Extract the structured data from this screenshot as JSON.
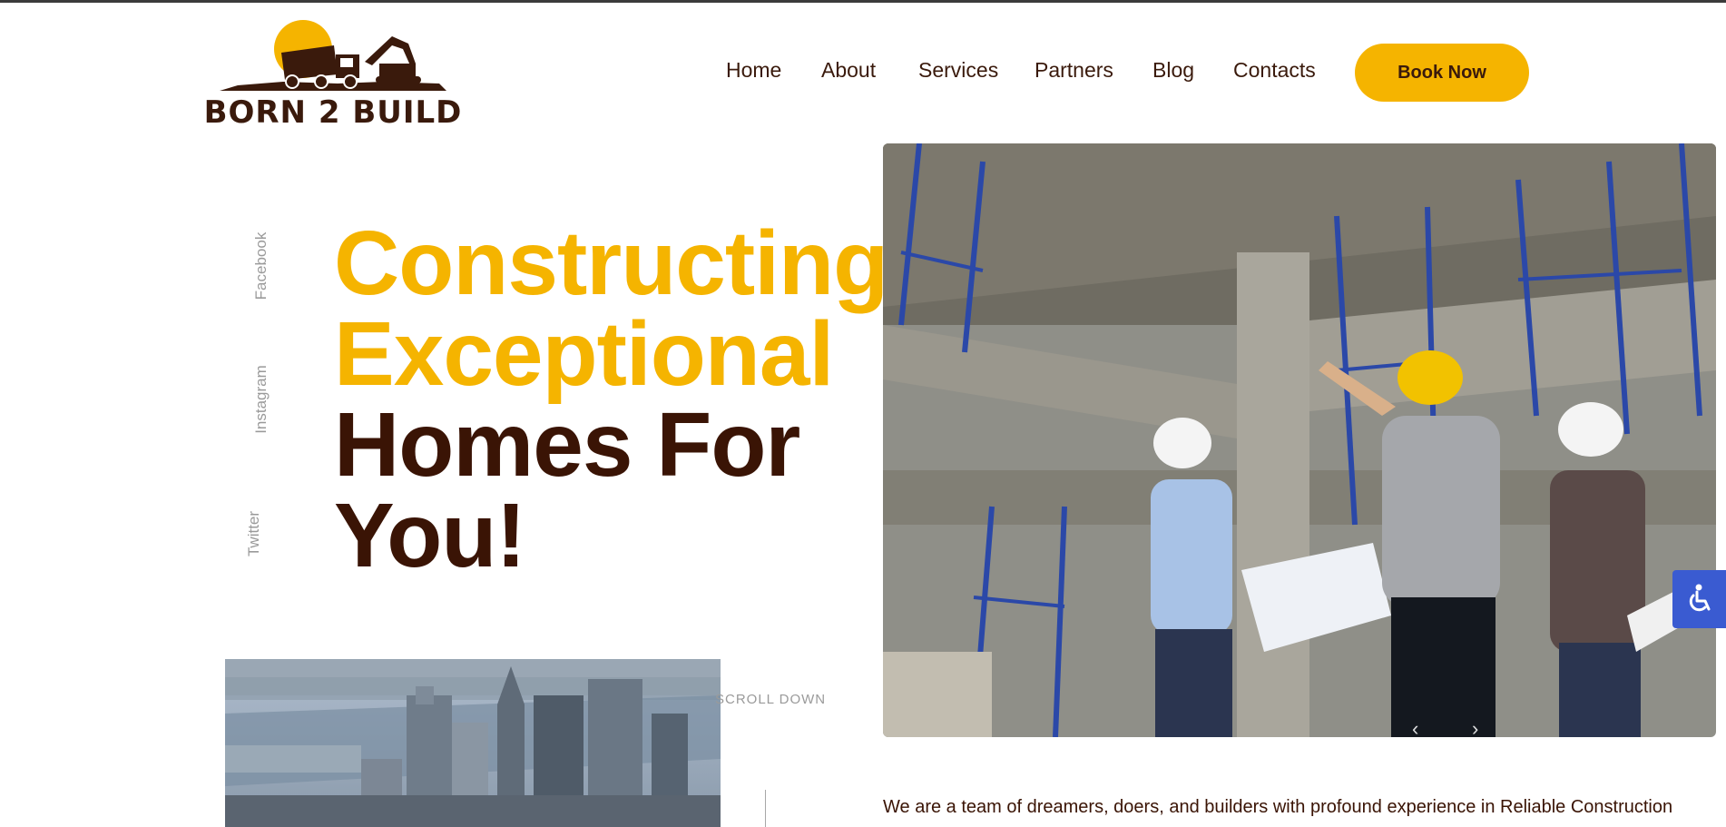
{
  "header": {
    "brand": "BORN 2 BUILD",
    "book_label": "Book Now"
  },
  "nav": {
    "items": [
      "Home",
      "About",
      "Services",
      "Partners",
      "Blog",
      "Contacts"
    ]
  },
  "social": {
    "facebook": "Facebook",
    "instagram": "Instagram",
    "twitter": "Twitter"
  },
  "hero": {
    "line1": "Constructing",
    "line2": "Exceptional",
    "line3": "Homes For",
    "line4": "You!",
    "scroll_label": "SCROLL DOWN",
    "intro": "We are a team of dreamers, doers, and builders with profound experience in Reliable Construction"
  },
  "colors": {
    "accent": "#f5b400",
    "brown": "#3a1405",
    "accessibility": "#3a5bd1"
  },
  "icons": {
    "accessibility": "wheelchair-icon",
    "prev": "chevron-left-icon",
    "next": "chevron-right-icon"
  }
}
